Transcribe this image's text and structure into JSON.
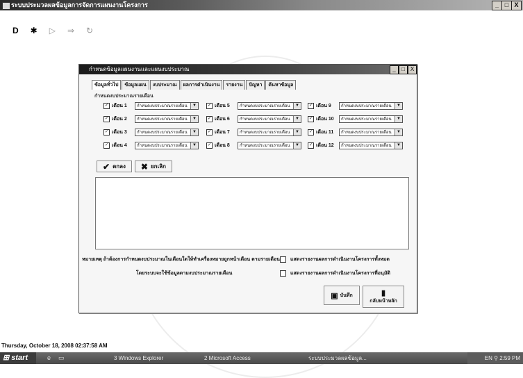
{
  "window": {
    "title": "ระบบประมวลผลข้อมูลการจัดการแผนงานโครงการ",
    "buttons": {
      "minimize": "_",
      "maximize": "□",
      "close": "X"
    }
  },
  "toolbar": {
    "items": [
      {
        "icon": "new-document-icon",
        "glyph": "D"
      },
      {
        "icon": "open-folder-icon",
        "glyph": "✱"
      },
      {
        "icon": "play-icon",
        "glyph": "▷"
      },
      {
        "icon": "arrow-right-icon",
        "glyph": "⇒"
      },
      {
        "icon": "refresh-icon",
        "glyph": "↻"
      }
    ]
  },
  "dialog": {
    "title": "กำหนดข้อมูลแผนงานและแผนงบประมาณ",
    "buttons": {
      "minimize": "_",
      "maximize": "□",
      "close": "X"
    },
    "tabs": [
      "ข้อมูลทั่วไป",
      "ข้อมูลแผน",
      "งบประมาณ",
      "ผลการดำเนินงาน",
      "รายงาน",
      "ปัญหา",
      "ค้นหาข้อมูล"
    ],
    "section_label": "กำหนดงบประมาณรายเดือน",
    "months": [
      {
        "label": "เดือน 1",
        "checked": true,
        "value": "กำหนดงบประมาณรายเดือน"
      },
      {
        "label": "เดือน 2",
        "checked": true,
        "value": "กำหนดงบประมาณรายเดือน"
      },
      {
        "label": "เดือน 3",
        "checked": true,
        "value": "กำหนดงบประมาณรายเดือน"
      },
      {
        "label": "เดือน 4",
        "checked": true,
        "value": "กำหนดงบประมาณรายเดือน"
      },
      {
        "label": "เดือน 5",
        "checked": true,
        "value": "กำหนดงบประมาณรายเดือน"
      },
      {
        "label": "เดือน 6",
        "checked": true,
        "value": "กำหนดงบประมาณรายเดือน"
      },
      {
        "label": "เดือน 7",
        "checked": true,
        "value": "กำหนดงบประมาณรายเดือน"
      },
      {
        "label": "เดือน 8",
        "checked": true,
        "value": "กำหนดงบประมาณรายเดือน"
      },
      {
        "label": "เดือน 9",
        "checked": true,
        "value": "กำหนดงบประมาณรายเดือน"
      },
      {
        "label": "เดือน 10",
        "checked": true,
        "value": "กำหนดงบประมาณรายเดือน"
      },
      {
        "label": "เดือน 11",
        "checked": true,
        "value": "กำหนดงบประมาณรายเดือน"
      },
      {
        "label": "เดือน 12",
        "checked": true,
        "value": "กำหนดงบประมาณรายเดือน"
      }
    ],
    "ok_button": "ตกลง",
    "cancel_button": "ยกเลิก",
    "note_line1": "หมายเหตุ ถ้าต้องการกำหนดงบประมาณในเดือนใดให้ทำเครื่องหมายถูกหน้าเดือน ตามรายเดือน",
    "note_line2": "โดยระบบจะใช้ข้อมูลตามงบประมาณรายเดือน",
    "option1": "แสดงรายงานผลการดำเนินงานโครงการทั้งหมด",
    "option2": "แสดงรายงานผลการดำเนินงานโครงการที่อนุมัติ",
    "save_button": "บันทึก",
    "back_button": "กลับหน้าหลัก"
  },
  "status": {
    "datetime": "Thursday, October 18, 2008   02:37:58 AM"
  },
  "taskbar": {
    "start": "start",
    "tasks": [
      "3 Windows Explorer",
      "2 Microsoft Access",
      "ระบบประมวลผลข้อมูล..."
    ],
    "tray": "EN  ⚲  2:59 PM"
  },
  "colors": {
    "titlebar": "#2a2a2a",
    "dialog_bg": "#f6f6f6",
    "taskbar": "#4a4a4a"
  }
}
